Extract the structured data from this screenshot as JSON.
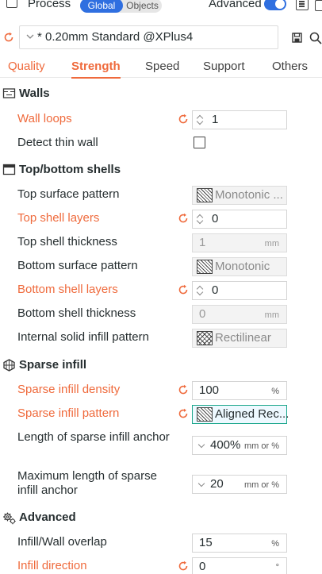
{
  "topbar": {
    "process_label": "Process",
    "global_label": "Global",
    "objects_label": "Objects",
    "advanced_label": "Advanced",
    "advanced_on": true
  },
  "preset": {
    "name": "* 0.20mm Standard @XPlus4"
  },
  "tabs": [
    {
      "label": "Quality",
      "state": "modified"
    },
    {
      "label": "Strength",
      "state": "active"
    },
    {
      "label": "Speed",
      "state": "normal"
    },
    {
      "label": "Support",
      "state": "normal"
    },
    {
      "label": "Others",
      "state": "normal"
    }
  ],
  "colors": {
    "accent": "#ef6a3c",
    "primary": "#2f6fe0",
    "highlight_border": "#18a58a",
    "text": "#262e30"
  },
  "sections": {
    "walls": {
      "title": "Walls",
      "wall_loops": {
        "label": "Wall loops",
        "value": "1"
      },
      "detect_thin_wall": {
        "label": "Detect thin wall",
        "checked": false
      }
    },
    "top_bottom": {
      "title": "Top/bottom shells",
      "top_surface_pattern": {
        "label": "Top surface pattern",
        "value": "Monotonic ..."
      },
      "top_shell_layers": {
        "label": "Top shell layers",
        "value": "0"
      },
      "top_shell_thickness": {
        "label": "Top shell thickness",
        "value": "1",
        "unit": "mm"
      },
      "bottom_surface_pattern": {
        "label": "Bottom surface pattern",
        "value": "Monotonic"
      },
      "bottom_shell_layers": {
        "label": "Bottom shell layers",
        "value": "0"
      },
      "bottom_shell_thickness": {
        "label": "Bottom shell thickness",
        "value": "0",
        "unit": "mm"
      },
      "internal_solid_infill_pattern": {
        "label": "Internal solid infill pattern",
        "value": "Rectilinear"
      }
    },
    "sparse_infill": {
      "title": "Sparse infill",
      "density": {
        "label": "Sparse infill density",
        "value": "100",
        "unit": "%"
      },
      "pattern": {
        "label": "Sparse infill pattern",
        "value": "Aligned Rec..."
      },
      "anchor_length": {
        "label": "Length of sparse infill anchor",
        "value": "400%",
        "unit": "mm or %"
      },
      "anchor_max_length": {
        "label": "Maximum length of sparse infill anchor",
        "value": "20",
        "unit": "mm or %"
      }
    },
    "advanced": {
      "title": "Advanced",
      "infill_wall_overlap": {
        "label": "Infill/Wall overlap",
        "value": "15",
        "unit": "%"
      },
      "infill_direction": {
        "label": "Infill direction",
        "value": "0",
        "unit": "°"
      }
    }
  }
}
